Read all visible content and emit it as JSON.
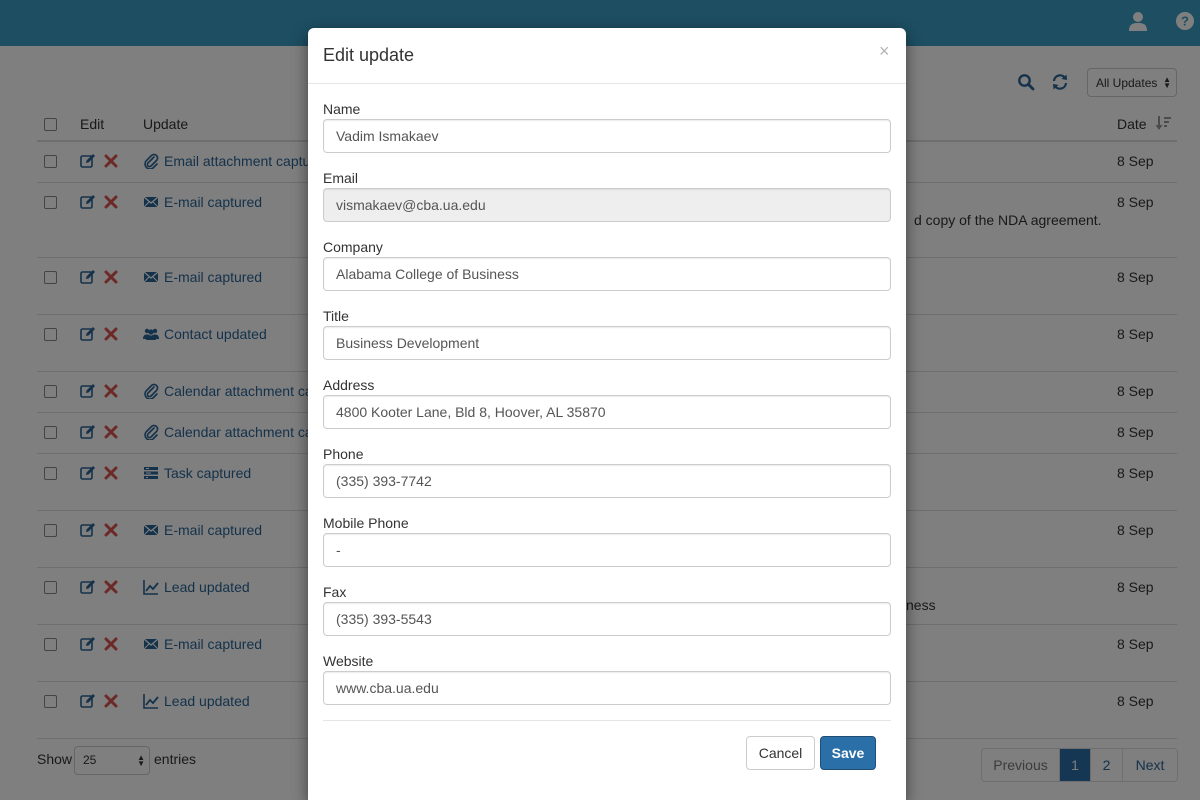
{
  "colors": {
    "topbar": "#3b9cc4",
    "link": "#2a6496",
    "delete": "#d9534f",
    "primary": "#2a6fa8"
  },
  "topbar": {
    "icons": [
      "user-icon",
      "help-icon"
    ]
  },
  "toolbar": {
    "search_icon": "search-icon",
    "refresh_icon": "refresh-icon",
    "filter_value": "All Updates"
  },
  "table": {
    "headers": {
      "edit": "Edit",
      "update": "Update",
      "date": "Date"
    },
    "rows": [
      {
        "icon": "paperclip-icon",
        "type": "Email attachment captured",
        "description": "",
        "date": "8 Sep"
      },
      {
        "icon": "envelope-icon",
        "type": "E-mail captured",
        "description": "d copy of the NDA agreement.",
        "date": "8 Sep"
      },
      {
        "icon": "envelope-icon",
        "type": "E-mail captured",
        "description": "",
        "date": "8 Sep"
      },
      {
        "icon": "users-icon",
        "type": "Contact updated",
        "description": "",
        "date": "8 Sep"
      },
      {
        "icon": "paperclip-icon",
        "type": "Calendar attachment captured",
        "description": "",
        "date": "8 Sep"
      },
      {
        "icon": "paperclip-icon",
        "type": "Calendar attachment captured",
        "description": "",
        "date": "8 Sep"
      },
      {
        "icon": "tasks-icon",
        "type": "Task captured",
        "description": "",
        "date": "8 Sep"
      },
      {
        "icon": "envelope-icon",
        "type": "E-mail captured",
        "description": "",
        "date": "8 Sep"
      },
      {
        "icon": "line-chart-icon",
        "type": "Lead updated",
        "description": "ness",
        "date": "8 Sep"
      },
      {
        "icon": "envelope-icon",
        "type": "E-mail captured",
        "description": "",
        "date": "8 Sep"
      },
      {
        "icon": "line-chart-icon",
        "type": "Lead updated",
        "description": "",
        "date": "8 Sep"
      }
    ]
  },
  "footer": {
    "show_label": "Show",
    "page_size": "25",
    "entries_label": "entries",
    "pagination": {
      "previous": "Previous",
      "pages": [
        "1",
        "2"
      ],
      "current": "1",
      "next": "Next"
    }
  },
  "modal": {
    "title": "Edit update",
    "close": "×",
    "fields": [
      {
        "label": "Name",
        "value": "Vadim Ismakaev",
        "readonly": false
      },
      {
        "label": "Email",
        "value": "vismakaev@cba.ua.edu",
        "readonly": true
      },
      {
        "label": "Company",
        "value": "Alabama College of Business",
        "readonly": false
      },
      {
        "label": "Title",
        "value": "Business Development",
        "readonly": false
      },
      {
        "label": "Address",
        "value": "4800 Kooter Lane, Bld 8, Hoover, AL 35870",
        "readonly": false
      },
      {
        "label": "Phone",
        "value": "(335) 393-7742",
        "readonly": false
      },
      {
        "label": "Mobile Phone",
        "value": "-",
        "readonly": false
      },
      {
        "label": "Fax",
        "value": "(335) 393-5543",
        "readonly": false
      },
      {
        "label": "Website",
        "value": "www.cba.ua.edu",
        "readonly": false
      }
    ],
    "cancel_label": "Cancel",
    "save_label": "Save"
  }
}
